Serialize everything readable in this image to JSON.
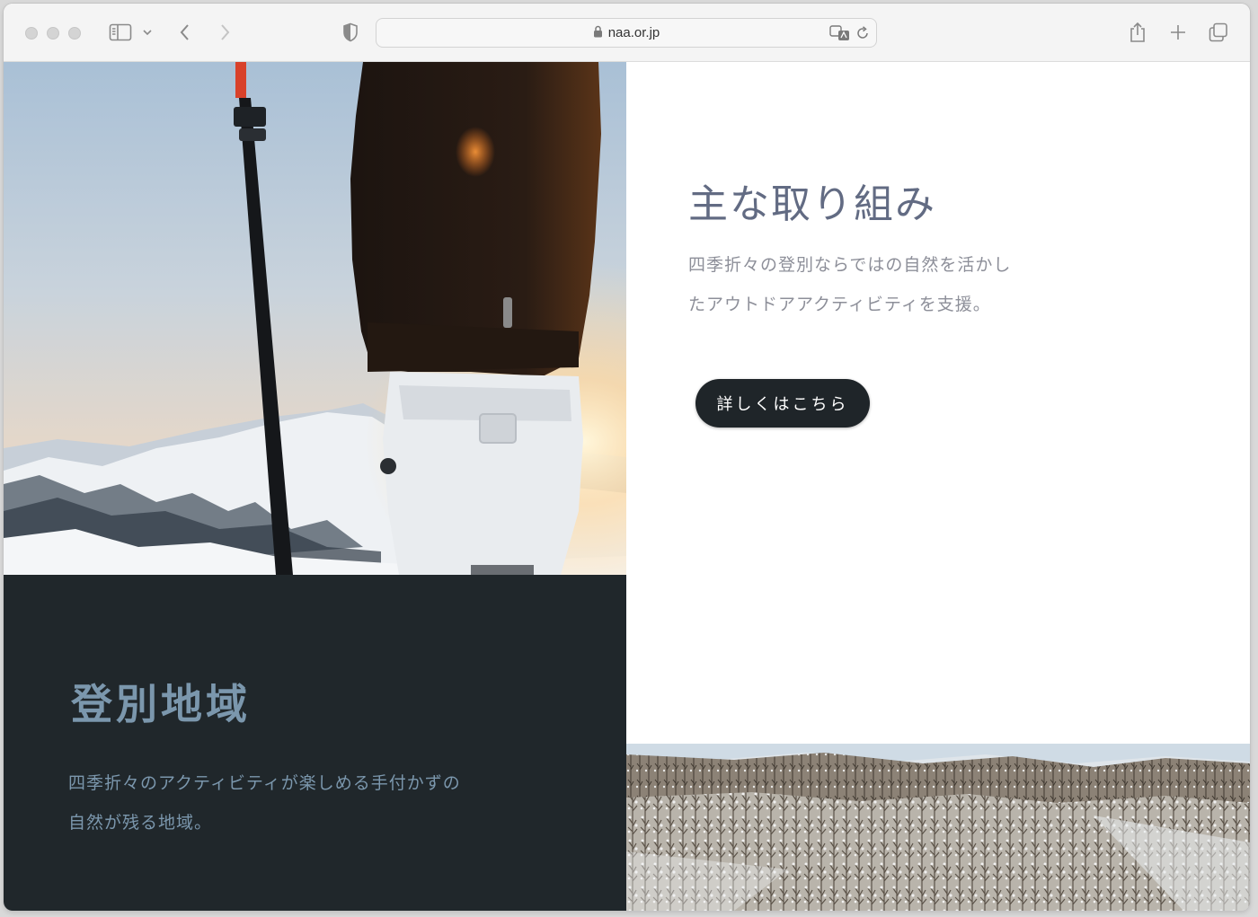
{
  "browser": {
    "url": "naa.or.jp",
    "icons": {
      "sidebar": "sidebar-icon",
      "back": "chevron-left-icon",
      "forward": "chevron-right-icon",
      "privacy": "shield-icon",
      "lock": "lock-icon",
      "translate": "translate-icon",
      "reload": "reload-icon",
      "share": "share-icon",
      "new_tab": "plus-icon",
      "tabs": "tabs-overview-icon"
    }
  },
  "initiatives": {
    "title": "主な取り組み",
    "desc_line1": "四季折々の登別ならではの自然を活かし",
    "desc_line2": "たアウトドアアクティビティを支援。",
    "button_label": "詳しくはこちら"
  },
  "region": {
    "title": "登別地域",
    "desc_line1": "四季折々のアクティビティが楽しめる手付かずの",
    "desc_line2": "自然が残る地域。"
  },
  "colors": {
    "dark_panel": "#20272b",
    "title_gray": "#626b83",
    "region_text": "#7b97ad",
    "button_bg": "#1f2529"
  }
}
